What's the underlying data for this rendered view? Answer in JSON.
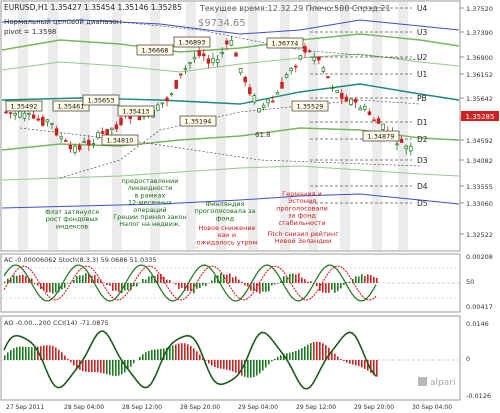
{
  "header": {
    "symbol_line": "EURUSD,H1  1.35427 1.35454 1.35146 1.35285",
    "subtitle": "Нормальный ценовой диапазон",
    "pivot_line": "pivot = 1.3598",
    "status_line": "Текущее время:12.32.29 Плечо:500 Спрэд:21",
    "balance": "$9734.65"
  },
  "levels": [
    {
      "label": "U4",
      "price": "1.37520"
    },
    {
      "label": "U3",
      "price": "1.37390"
    },
    {
      "label": "U2",
      "price": "1.36900"
    },
    {
      "label": "U1",
      "price": "1.36152"
    },
    {
      "label": "PB",
      "price": "1.35642"
    },
    {
      "label": "D1",
      "price": "1.35285"
    },
    {
      "label": "D2",
      "price": "1.34592"
    },
    {
      "label": "D3",
      "price": "1.34592"
    },
    {
      "label": "D4",
      "price": "1.33555"
    },
    {
      "label": "D5",
      "price": "1.33555"
    }
  ],
  "price_axis": [
    "1.37520",
    "1.37390",
    "1.36900",
    "1.36152",
    "1.35642",
    "1.35285",
    "1.34592",
    "1.34082",
    "1.33555",
    "1.33060",
    "1.32522"
  ],
  "price_badge": "1.35285",
  "price_boxes": [
    {
      "text": "1.35492"
    },
    {
      "text": "1.35461"
    },
    {
      "text": "1.35653"
    },
    {
      "text": "1.36668"
    },
    {
      "text": "1.35413"
    },
    {
      "text": "1.36893"
    },
    {
      "text": "1.34810"
    },
    {
      "text": "1.35194"
    },
    {
      "text": "1.36774"
    },
    {
      "text": "1.35529"
    },
    {
      "text": "1.34879"
    }
  ],
  "marker_61": "61.8",
  "annotations": [
    {
      "lines": [
        "Флэт затянулся",
        "рост фондовых",
        "индексов"
      ]
    },
    {
      "lines": [
        "предоставлении",
        "ликвидности",
        "в рамках",
        "12-месячных",
        "операций",
        "Греции принял закон",
        "Налог на недвиж."
      ]
    },
    {
      "lines": [
        "Финляндия",
        "проголосовала за",
        "фонд"
      ]
    },
    {
      "lines": [
        "Новое снижение",
        "как и",
        "ожидалось утром"
      ]
    },
    {
      "lines": [
        "Германия и",
        "Эстония",
        "проголосовали",
        "за фонд",
        "стабильности"
      ]
    },
    {
      "lines": [
        "Fitch снизил рейтинг",
        "Новой Зеландии"
      ]
    }
  ],
  "panel_ac": {
    "header": "AC -0.00006062   Stoch(8,3,3) 59.0686  51.0335",
    "ticks": [
      "0.00208",
      "50",
      "0.00417"
    ]
  },
  "panel_ao": {
    "header": "AO -0.00...200   CCI(14) -71.0875",
    "ticks": [
      "0.0146",
      "0",
      "-0.0126"
    ]
  },
  "time_axis": [
    "27 Sep 2011",
    "28 Sep 04:00",
    "28 Sep 12:00",
    "28 Sep 20:00",
    "29 Sep 04:00",
    "29 Sep 12:00",
    "29 Sep 20:00",
    "30 Sep 04:00"
  ],
  "watermark": "alpari",
  "colors": {
    "bg": "#ffffff",
    "up_candle": "#1e7a1e",
    "down_candle": "#cc2222",
    "band_green": "#7ab55c",
    "band_blue": "#3a4fd0",
    "teal_line": "#1b8a7a",
    "level_line": "#444444",
    "annot_red": "#cc1f1f",
    "annot_green": "#1e6b1e",
    "badge_bg": "#cc2222",
    "stripe": "#dcdcdc"
  }
}
